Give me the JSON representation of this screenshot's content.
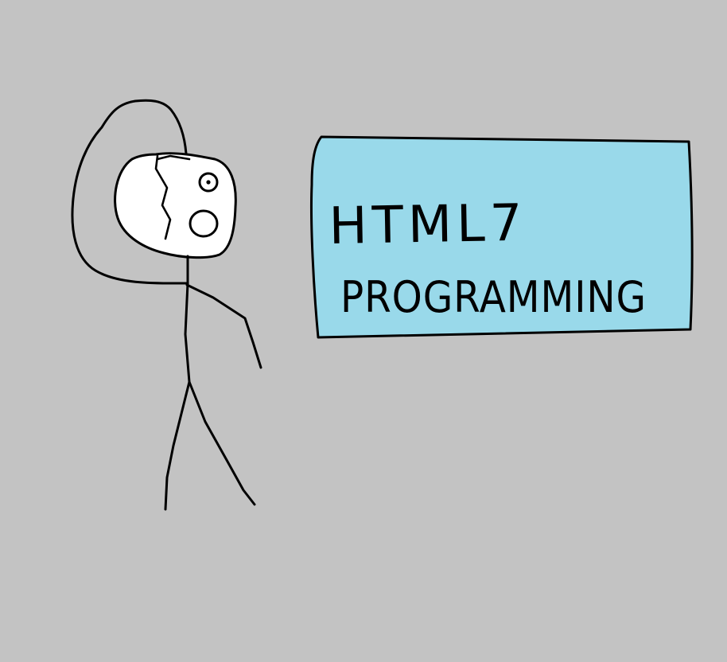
{
  "colors": {
    "background": "#c3c3c3",
    "sign_fill": "#99d9ea",
    "face_fill": "#ffffff",
    "ink": "#000000"
  },
  "sign": {
    "line1": "HTML7",
    "line2": "PROGRAMMING"
  }
}
